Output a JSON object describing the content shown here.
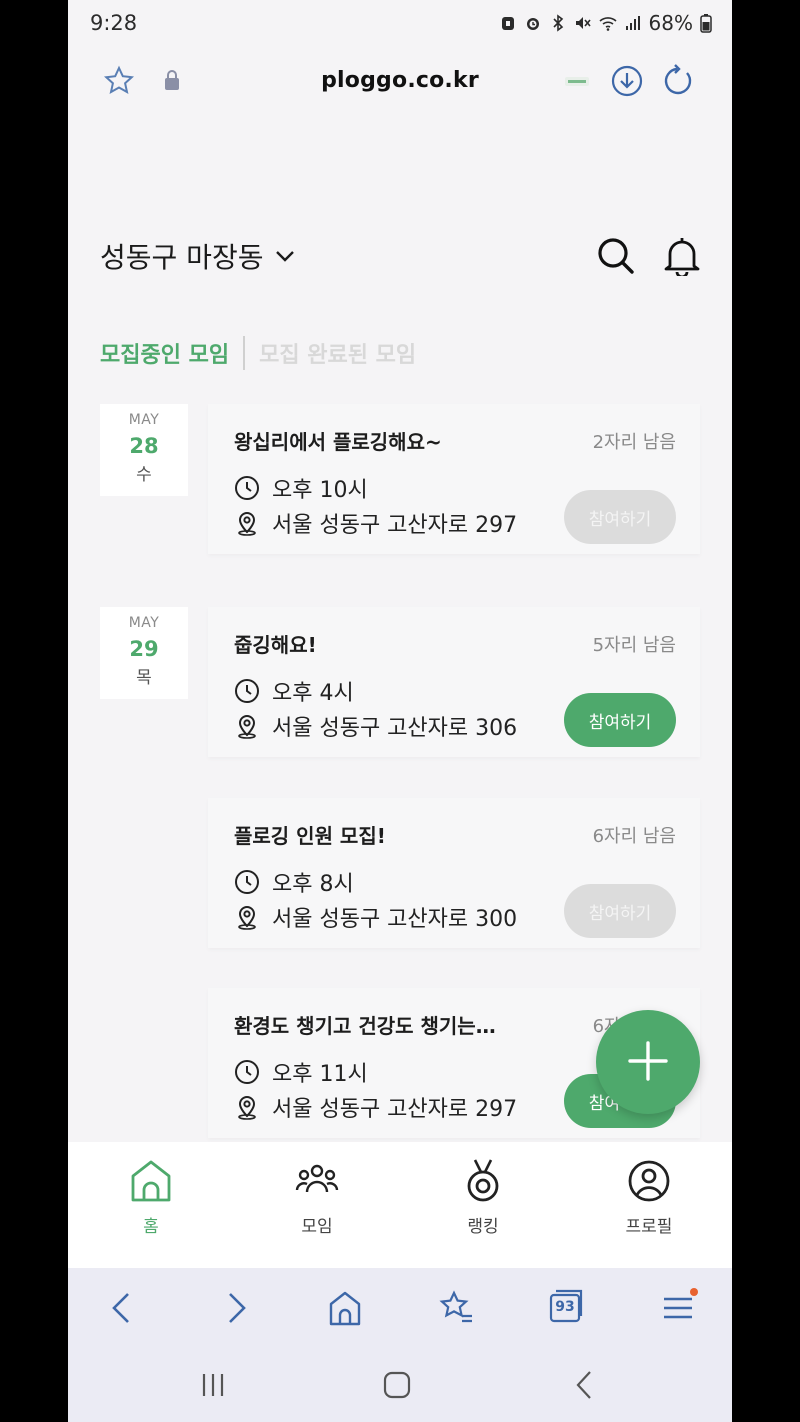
{
  "status_bar": {
    "time": "9:28",
    "battery": "68%"
  },
  "browser": {
    "url": "ploggo.co.kr"
  },
  "header": {
    "location": "성동구 마장동"
  },
  "tabs": {
    "recruiting": "모집중인 모임",
    "completed": "모집 완료된 모임"
  },
  "dates": [
    {
      "month": "MAY",
      "day": "28",
      "weekday": "수"
    },
    {
      "month": "MAY",
      "day": "29",
      "weekday": "목"
    }
  ],
  "meetups": [
    {
      "title": "왕십리에서 플로깅해요~",
      "seats": "2자리 남음",
      "time": "오후 10시",
      "place": "서울 성동구 고산자로 297",
      "button": "참여하기"
    },
    {
      "title": "줍깅해요!",
      "seats": "5자리 남음",
      "time": "오후 4시",
      "place": "서울 성동구 고산자로 306",
      "button": "참여하기"
    },
    {
      "title": "플로깅 인원 모집!",
      "seats": "6자리 남음",
      "time": "오후 8시",
      "place": "서울 성동구 고산자로 300",
      "button": "참여하기"
    },
    {
      "title": "환경도 챙기고 건강도 챙기는…",
      "seats": "6자리 남음",
      "time": "오후 11시",
      "place": "서울 성동구 고산자로 297",
      "button": "참여하기"
    }
  ],
  "bottom_nav": [
    {
      "label": "홈",
      "icon": "home-icon",
      "active": true
    },
    {
      "label": "모임",
      "icon": "group-icon",
      "active": false
    },
    {
      "label": "랭킹",
      "icon": "medal-icon",
      "active": false
    },
    {
      "label": "프로필",
      "icon": "profile-icon",
      "active": false
    }
  ],
  "browser_toolbar": {
    "tab_count": "93"
  },
  "colors": {
    "accent": "#4ea96c",
    "disabled_button": "#dcdcdc",
    "notification_dot": "#e8622f"
  }
}
